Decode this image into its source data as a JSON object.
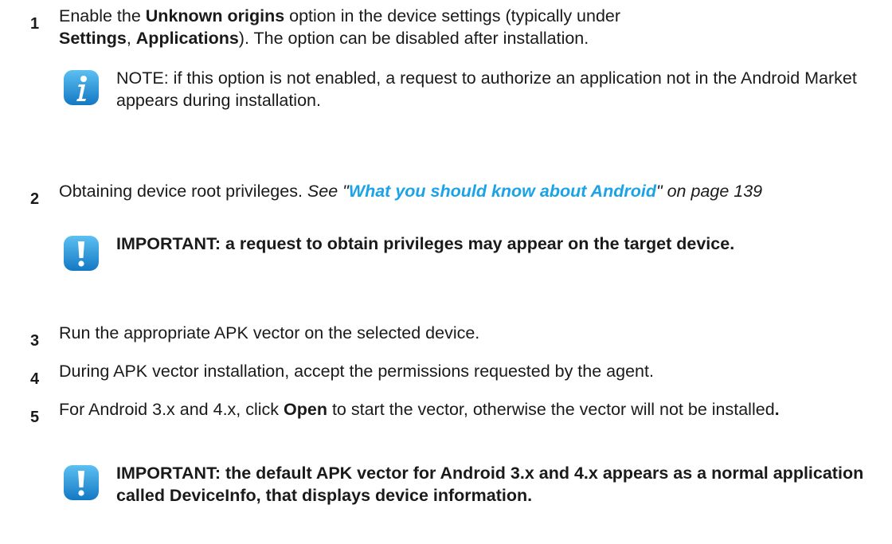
{
  "steps": [
    {
      "number": "1",
      "pre": "Enable the ",
      "bold1": "Unknown origins",
      "mid1": " option in the device settings (typically under ",
      "bold2": "Settings",
      "mid2": ", ",
      "bold3": "Applications",
      "post": "). The option can be disabled after installation."
    },
    {
      "number": "2",
      "pre": "Obtaining device root privileges. ",
      "see": "See \"",
      "link": "What you should know about Android",
      "after_link": "\" on page 139"
    },
    {
      "number": "3",
      "text": "Run the appropriate APK vector on the selected device."
    },
    {
      "number": "4",
      "text": "During APK vector installation, accept the permissions requested by the agent."
    },
    {
      "number": "5",
      "pre": "For Android 3.x and 4.x, click ",
      "bold": "Open",
      "post": " to start the vector, otherwise the vector will not be installed",
      "end": "."
    }
  ],
  "notes": [
    {
      "icon": "info-icon",
      "text": "NOTE: if this option is not enabled, a request to authorize an application not in the Android Market appears during installation."
    },
    {
      "icon": "important-icon",
      "text": "IMPORTANT: a request to obtain privileges may appear on the target device."
    },
    {
      "icon": "important-icon",
      "text": "IMPORTANT: the default APK vector for Android 3.x and 4.x appears as a normal application called DeviceInfo, that displays device information."
    }
  ],
  "colors": {
    "link": "#1aa3e8",
    "icon_blue": "#1e8fd6"
  }
}
